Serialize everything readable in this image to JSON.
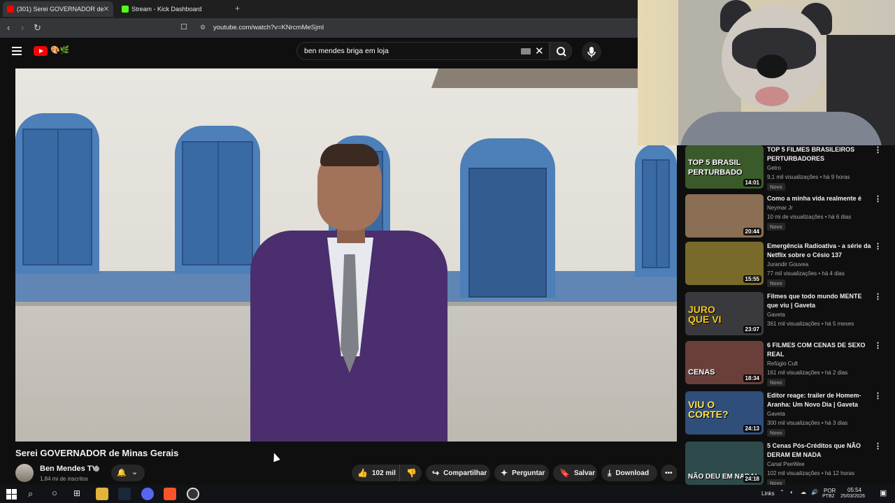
{
  "browser": {
    "tabs": [
      {
        "label": "(301) Serei GOVERNADOR de",
        "active": true
      },
      {
        "label": "Stream - Kick Dashboard",
        "active": false
      }
    ],
    "new_tab": "+",
    "url": "youtube.com/watch?v=KNrcmMeSjml"
  },
  "youtube": {
    "search": {
      "query": "ben mendes briga  em loja"
    },
    "video": {
      "title": "Serei GOVERNADOR de Minas Gerais",
      "channel": "Ben Mendes TV",
      "subscribers": "1,84 mi de inscritos",
      "likes": "102 mil",
      "actions": {
        "share": "Compartilhar",
        "ask": "Perguntar",
        "save": "Salvar",
        "download": "Download"
      }
    },
    "recommendations": [
      {
        "title": "TOP 5 FILMES BRASILEIROS PERTURBADORES",
        "channel": "Getro",
        "meta": "9,1 mil visualizações • há 9 horas",
        "badge": "Novo",
        "duration": "14:01",
        "thumb_text": "TOP 5 BRASIL PERTURBADO",
        "thumb_color": "#3a5a2a"
      },
      {
        "title": "Como a minha vida realmente é",
        "channel": "Neymar Jr",
        "meta": "10 mi de visualizações • há 6 dias",
        "badge": "Novo",
        "duration": "20:44",
        "thumb_text": "",
        "thumb_color": "#8a6f55"
      },
      {
        "title": "Emergência Radioativa - a série da Netflix sobre o Césio 137",
        "channel": "Jurandir Gouvea",
        "meta": "77 mil visualizações • há 4 dias",
        "badge": "Novo",
        "duration": "15:55",
        "thumb_text": "",
        "thumb_color": "#7a6a2a"
      },
      {
        "title": "Filmes que todo mundo MENTE que viu | Gaveta",
        "channel": "Gaveta",
        "meta": "361 mil visualizações • há 5 meses",
        "badge": "",
        "duration": "23:07",
        "thumb_text": "JURO QUE VI",
        "thumb_color": "#3a3a3e"
      },
      {
        "title": "6 FILMES COM CENAS DE SEXO REAL",
        "channel": "Refúgio Cult",
        "meta": "161 mil visualizações • há 2 dias",
        "badge": "Novo",
        "duration": "18:34",
        "thumb_text": "CENAS",
        "thumb_color": "#6a3f3a"
      },
      {
        "title": "Editor reage: trailer de Homem-Aranha: Um Novo Dia | Gaveta",
        "channel": "Gaveta",
        "meta": "300 mil visualizações • há 3 dias",
        "badge": "Novo",
        "duration": "24:13",
        "thumb_text": "VIU O CORTE?",
        "thumb_color": "#2f4f7a"
      },
      {
        "title": "5 Cenas Pós-Créditos que NÃO DERAM EM NADA",
        "channel": "Canal PeeWee",
        "meta": "102 mil visualizações • há 12 horas",
        "badge": "Novo",
        "duration": "24:18",
        "thumb_text": "NÃO DEU EM NADA!",
        "thumb_color": "#2e4a4a"
      }
    ]
  },
  "taskbar": {
    "links": "Links",
    "lang": "POR",
    "lang2": "PTB2",
    "time": "05:54",
    "date": "25/03/2026"
  },
  "colors": {
    "accent": "#ff0000",
    "bg": "#0f0f0f"
  }
}
